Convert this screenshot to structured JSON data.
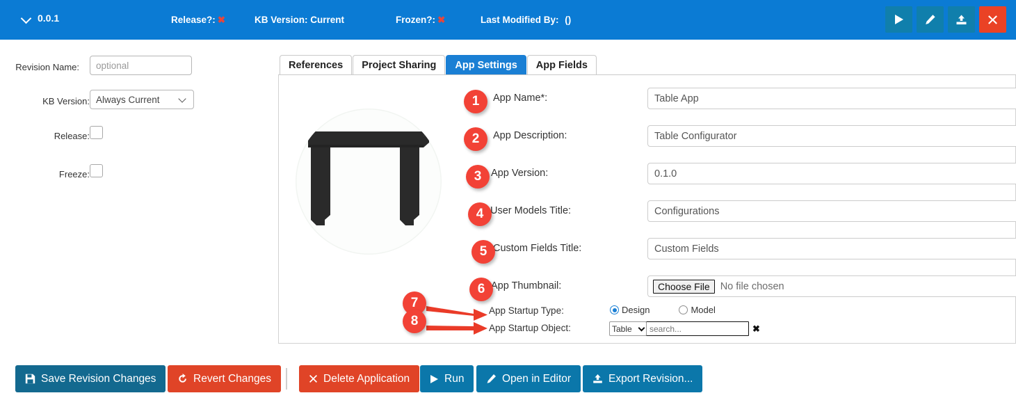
{
  "header": {
    "revision_label": "0.0.1",
    "chevron_icon": "chevron-down-icon",
    "meta": [
      {
        "label": "Release?:",
        "value": "✖",
        "value_is_x": true
      },
      {
        "label": "KB Version:",
        "value": "Current",
        "value_is_x": false
      },
      {
        "label": "Frozen?:",
        "value": "✖",
        "value_is_x": true
      },
      {
        "label": "Last Modified By:",
        "value": "()",
        "value_is_x": false
      }
    ],
    "buttons": [
      {
        "name": "run-button",
        "icon": "play-icon",
        "color": "#107fac"
      },
      {
        "name": "edit-button",
        "icon": "pencil-icon",
        "color": "#107fac"
      },
      {
        "name": "export-button",
        "icon": "upload-icon",
        "color": "#107fac"
      },
      {
        "name": "close-button",
        "icon": "close-x-icon",
        "color": "#ea4225"
      }
    ]
  },
  "left_form": {
    "revision_name": {
      "label": "Revision Name:",
      "placeholder": "optional",
      "value": ""
    },
    "kb_version": {
      "label": "KB Version:",
      "selected": "Always Current"
    },
    "release": {
      "label": "Release:",
      "checked": false
    },
    "freeze": {
      "label": "Freeze:",
      "checked": false
    }
  },
  "tabs": [
    {
      "label": "References",
      "active": false
    },
    {
      "label": "Project Sharing",
      "active": false
    },
    {
      "label": "App Settings",
      "active": true
    },
    {
      "label": "App Fields",
      "active": false
    }
  ],
  "app_settings": {
    "thumbnail_alt": "black table product thumbnail",
    "fields": [
      {
        "badge": "1",
        "label": "App Name*:",
        "value": "Table App"
      },
      {
        "badge": "2",
        "label": "App Description:",
        "value": "Table Configurator"
      },
      {
        "badge": "3",
        "label": "App Version:",
        "value": "0.1.0"
      },
      {
        "badge": "4",
        "label": "User Models Title:",
        "value": "Configurations"
      },
      {
        "badge": "5",
        "label": "Custom Fields Title:",
        "value": "Custom Fields"
      }
    ],
    "thumbnail_field": {
      "badge": "6",
      "label": "App Thumbnail:",
      "choose_label": "Choose File",
      "no_file_text": "No file chosen"
    },
    "startup_type": {
      "badge": "7",
      "label": "App Startup Type:",
      "options": [
        {
          "label": "Design",
          "checked": true
        },
        {
          "label": "Model",
          "checked": false
        }
      ]
    },
    "startup_object": {
      "badge": "8",
      "label": "App Startup Object:",
      "select_value": "Table",
      "search_placeholder": "search...",
      "clear_icon": "clear-x-icon"
    }
  },
  "bottom_toolbar": [
    {
      "label": "Save Revision Changes",
      "icon": "save-disk-icon",
      "style": "dkblue"
    },
    {
      "label": "Revert Changes",
      "icon": "undo-icon",
      "style": "red"
    },
    {
      "label": "Delete Application",
      "icon": "close-x-icon",
      "style": "red"
    },
    {
      "label": "Run",
      "icon": "play-icon",
      "style": "blue"
    },
    {
      "label": "Open in Editor",
      "icon": "pencil-icon",
      "style": "blue"
    },
    {
      "label": "Export Revision...",
      "icon": "upload-icon",
      "style": "blue"
    }
  ],
  "colors": {
    "header_blue": "#0b7bd4",
    "tab_active_blue": "#1a7fd4",
    "badge_red": "#f24236",
    "button_red": "#e04427",
    "button_blue": "#0b77aa",
    "button_dark_blue": "#13698f",
    "header_icon_teal": "#107fac",
    "header_icon_red": "#ea4225"
  }
}
